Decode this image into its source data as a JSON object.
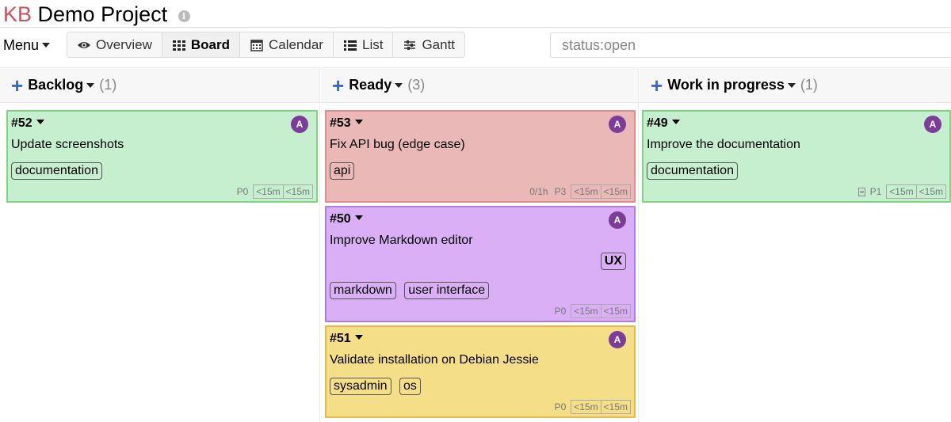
{
  "header": {
    "kb": "KB",
    "title": "Demo Project",
    "info_icon": "i"
  },
  "toolbar": {
    "menu_label": "Menu",
    "views": [
      {
        "label": "Overview",
        "icon": "eye-icon"
      },
      {
        "label": "Board",
        "icon": "grid-icon",
        "active": true
      },
      {
        "label": "Calendar",
        "icon": "calendar-icon"
      },
      {
        "label": "List",
        "icon": "list-icon"
      },
      {
        "label": "Gantt",
        "icon": "sliders-icon"
      }
    ],
    "search_value": "status:open"
  },
  "columns": [
    {
      "name": "Backlog",
      "count": "(1)"
    },
    {
      "name": "Ready",
      "count": "(3)"
    },
    {
      "name": "Work in progress",
      "count": "(1)"
    }
  ],
  "cards": {
    "c52": {
      "id": "#52",
      "avatar": "A",
      "title": "Update screenshots",
      "tags": [
        "documentation"
      ],
      "priority": "P0",
      "time": [
        "<15m",
        "<15m"
      ]
    },
    "c53": {
      "id": "#53",
      "avatar": "A",
      "title": "Fix API bug (edge case)",
      "tags": [
        "api"
      ],
      "estimate": "0/1h",
      "priority": "P3",
      "time": [
        "<15m",
        "<15m"
      ]
    },
    "c50": {
      "id": "#50",
      "avatar": "A",
      "title": "Improve Markdown editor",
      "extra_tag": "UX",
      "tags": [
        "markdown",
        "user interface"
      ],
      "priority": "P0",
      "time": [
        "<15m",
        "<15m"
      ]
    },
    "c51": {
      "id": "#51",
      "avatar": "A",
      "title": "Validate installation on Debian Jessie",
      "tags": [
        "sysadmin",
        "os"
      ],
      "priority": "P0",
      "time": [
        "<15m",
        "<15m"
      ]
    },
    "c49": {
      "id": "#49",
      "avatar": "A",
      "title": "Improve the documentation",
      "tags": [
        "documentation"
      ],
      "priority": "P1",
      "time": [
        "<15m",
        "<15m"
      ]
    }
  },
  "colors": {
    "green": "#c6efcf",
    "red": "#ebb8b8",
    "purple": "#daaff5",
    "yellow": "#f5de88",
    "avatar": "#7d3c98",
    "plus": "#3a6ac9"
  }
}
